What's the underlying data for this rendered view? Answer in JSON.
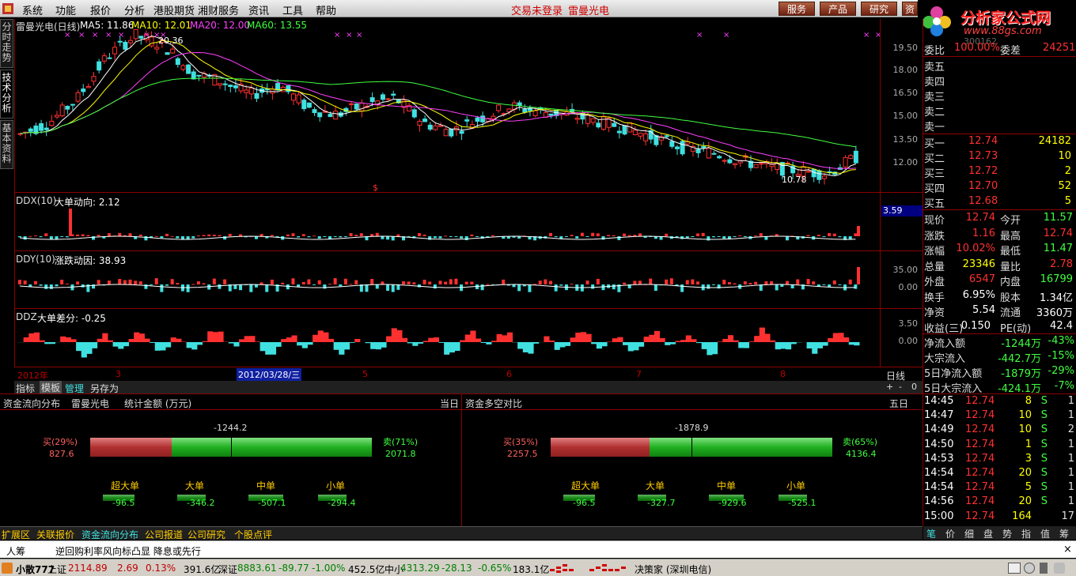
{
  "menu": {
    "items": [
      "系统",
      "功能",
      "报价",
      "分析",
      "港股期货",
      "湘财服务",
      "资讯",
      "工具",
      "帮助"
    ],
    "login_status": "交易未登录",
    "stock_link": "雷曼光电",
    "buttons": [
      "服务",
      "产品",
      "研究",
      "资"
    ]
  },
  "brand": {
    "title": "分析家公式网",
    "url": "www.88gs.com",
    "code_hint": "300162"
  },
  "sidetabs": [
    "分时走势",
    "技术分析",
    "基本资料"
  ],
  "main_chart": {
    "title": "雷曼光电(日线)",
    "ma5": "MA5: 11.86",
    "ma10": "MA10: 12.01",
    "ma20": "MA20: 12.00",
    "ma60": "MA60: 13.55",
    "high_label": "20.36",
    "low_label": "10.78",
    "y_ticks": [
      "19.50",
      "18.00",
      "16.50",
      "15.00",
      "13.50",
      "12.00"
    ]
  },
  "ddx": {
    "title": "DDX(10)",
    "label": "大单动向: 2.12",
    "y_ticks": [
      "3.59"
    ],
    "hilite": "3.59"
  },
  "ddy": {
    "title": "DDY(10)",
    "label": "涨跌动因: 38.93",
    "y_ticks": [
      "35.00",
      "0.00"
    ]
  },
  "ddz": {
    "title": "DDZ",
    "label": "大单差分: -0.25",
    "y_ticks": [
      "3.50",
      "0.00"
    ]
  },
  "xaxis": {
    "labels": [
      "2012年",
      "3",
      "2012/03/28/三",
      "5",
      "6",
      "7",
      "8"
    ],
    "period": "日线"
  },
  "toolbar": {
    "items": [
      "指标",
      "模板",
      "管理",
      "另存为"
    ],
    "ctrl": [
      "+",
      "-",
      "0"
    ]
  },
  "order_book": {
    "top": {
      "label": "委比",
      "value": "100.00%",
      "label2": "委差",
      "value2": "24251"
    },
    "sells": [
      {
        "label": "卖五",
        "price": "",
        "vol": ""
      },
      {
        "label": "卖四",
        "price": "",
        "vol": ""
      },
      {
        "label": "卖三",
        "price": "",
        "vol": ""
      },
      {
        "label": "卖二",
        "price": "",
        "vol": ""
      },
      {
        "label": "卖一",
        "price": "",
        "vol": ""
      }
    ],
    "buys": [
      {
        "label": "买一",
        "price": "12.74",
        "vol": "24182"
      },
      {
        "label": "买二",
        "price": "12.73",
        "vol": "10"
      },
      {
        "label": "买三",
        "price": "12.72",
        "vol": "2"
      },
      {
        "label": "买四",
        "price": "12.70",
        "vol": "52"
      },
      {
        "label": "买五",
        "price": "12.68",
        "vol": "5"
      }
    ]
  },
  "quote": [
    {
      "l1": "现价",
      "v1": "12.74",
      "l2": "今开",
      "v2": "11.57"
    },
    {
      "l1": "涨跌",
      "v1": "1.16",
      "l2": "最高",
      "v2": "12.74"
    },
    {
      "l1": "涨幅",
      "v1": "10.02%",
      "l2": "最低",
      "v2": "11.47"
    },
    {
      "l1": "总量",
      "v1": "23346",
      "l2": "量比",
      "v2": "2.78"
    },
    {
      "l1": "外盘",
      "v1": "6547",
      "l2": "内盘",
      "v2": "16799"
    },
    {
      "l1": "换手",
      "v1": "6.95%",
      "l2": "股本",
      "v2": "1.34亿"
    },
    {
      "l1": "净资",
      "v1": "5.54",
      "l2": "流通",
      "v2": "3360万"
    },
    {
      "l1": "收益(三)",
      "v1": "0.150",
      "l2": "PE(动)",
      "v2": "42.4"
    }
  ],
  "flows": [
    {
      "label": "净流入额",
      "value": "-1244万",
      "pct": "-43%"
    },
    {
      "label": "大宗流入",
      "value": "-442.7万",
      "pct": "-15%"
    },
    {
      "label": "5日净流入额",
      "value": "-1879万",
      "pct": "-29%"
    },
    {
      "label": "5日大宗流入",
      "value": "-424.1万",
      "pct": "-7%"
    }
  ],
  "ticks": [
    {
      "time": "14:45",
      "price": "12.74",
      "vol": "8",
      "side": "S",
      "n": "1"
    },
    {
      "time": "14:47",
      "price": "12.74",
      "vol": "10",
      "side": "S",
      "n": "1"
    },
    {
      "time": "14:49",
      "price": "12.74",
      "vol": "10",
      "side": "S",
      "n": "2"
    },
    {
      "time": "14:50",
      "price": "12.74",
      "vol": "1",
      "side": "S",
      "n": "1"
    },
    {
      "time": "14:53",
      "price": "12.74",
      "vol": "3",
      "side": "S",
      "n": "1"
    },
    {
      "time": "14:54",
      "price": "12.74",
      "vol": "20",
      "side": "S",
      "n": "1"
    },
    {
      "time": "14:54",
      "price": "12.74",
      "vol": "5",
      "side": "S",
      "n": "1"
    },
    {
      "time": "14:56",
      "price": "12.74",
      "vol": "20",
      "side": "S",
      "n": "1"
    },
    {
      "time": "15:00",
      "price": "12.74",
      "vol": "164",
      "side": "",
      "n": "17"
    }
  ],
  "right_tabs": [
    "笔",
    "价",
    "细",
    "盘",
    "势",
    "指",
    "值",
    "筹"
  ],
  "fund_flow": {
    "title": "资金流向分布",
    "stock": "雷曼光电",
    "unit": "统计金额 (万元)",
    "period": "当日",
    "buy_label": "买(29%)",
    "buy_val": "827.6",
    "sell_label": "卖(71%)",
    "sell_val": "2071.8",
    "net": "-1244.2",
    "buy_frac": 0.29,
    "cats": [
      {
        "name": "超大单",
        "val": "-96.5"
      },
      {
        "name": "大单",
        "val": "-346.2"
      },
      {
        "name": "中单",
        "val": "-507.1"
      },
      {
        "name": "小单",
        "val": "-294.4"
      }
    ]
  },
  "fund_compare": {
    "title": "资金多空对比",
    "period": "五日",
    "buy_label": "买(35%)",
    "buy_val": "2257.5",
    "sell_label": "卖(65%)",
    "sell_val": "4136.4",
    "net": "-1878.9",
    "buy_frac": 0.35,
    "cats": [
      {
        "name": "超大单",
        "val": "-96.5"
      },
      {
        "name": "大单",
        "val": "-327.7"
      },
      {
        "name": "中单",
        "val": "-929.6"
      },
      {
        "name": "小单",
        "val": "-525.1"
      }
    ]
  },
  "bottom_tabs": [
    "扩展区",
    "关联报价",
    "资金流向分布",
    "公司报道",
    "公司研究",
    "个股点评"
  ],
  "news": {
    "tag": "人筹",
    "text": "逆回购利率风向标凸显 降息或先行"
  },
  "status": {
    "app": "小散777",
    "sh_name": "上证",
    "sh_val": "2114.89",
    "sh_chg": "2.69",
    "sh_pct": "0.13%",
    "sh_amt": "391.6亿",
    "sz_name": "深证",
    "sz_val": "8883.61",
    "sz_chg": "-89.77",
    "sz_pct": "-1.00%",
    "sz_amt": "452.5亿",
    "zx_name": "中小",
    "zx_val": "4313.29",
    "zx_chg": "-28.13",
    "zx_pct": "-0.65%",
    "zx_amt": "183.1亿",
    "server": "决策家 (深圳电信)"
  }
}
